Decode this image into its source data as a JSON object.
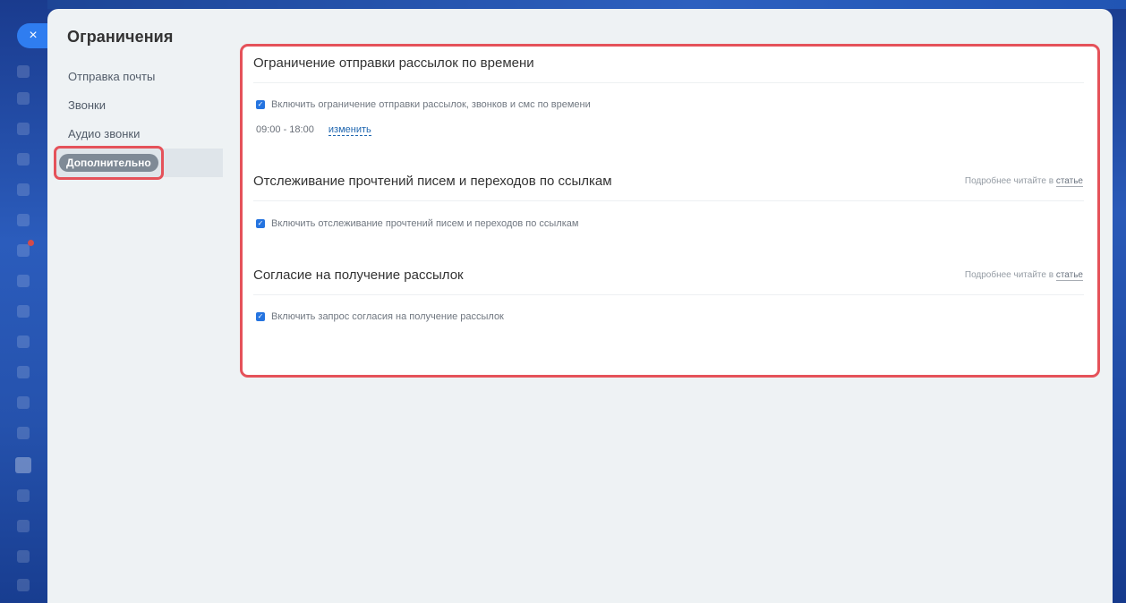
{
  "close": {
    "icon": "close-icon",
    "glyph": "×"
  },
  "panel": {
    "title": "Ограничения"
  },
  "nav": {
    "items": [
      {
        "label": "Отправка почты"
      },
      {
        "label": "Звонки"
      },
      {
        "label": "Аудио звонки"
      },
      {
        "label": "Дополнительно",
        "selected": true
      }
    ]
  },
  "sections": {
    "time_limit": {
      "title": "Ограничение отправки рассылок по времени",
      "checkbox_label": "Включить ограничение отправки рассылок, звонков и смс по времени",
      "checked": true,
      "time_range": "09:00 - 18:00",
      "edit_label": "изменить"
    },
    "tracking": {
      "title": "Отслеживание прочтений писем и переходов по ссылкам",
      "read_more_prefix": "Подробнее читайте в",
      "read_more_link": "статье",
      "checkbox_label": "Включить отслеживание прочтений писем и переходов по ссылкам",
      "checked": true
    },
    "consent": {
      "title": "Согласие на получение рассылок",
      "read_more_prefix": "Подробнее читайте в",
      "read_more_link": "статье",
      "checkbox_label": "Включить запрос согласия на получение рассылок",
      "checked": true
    }
  },
  "colors": {
    "accent": "#2f7df0",
    "highlight": "#e5525a",
    "checkbox": "#2574e0",
    "link": "#2067b0"
  }
}
